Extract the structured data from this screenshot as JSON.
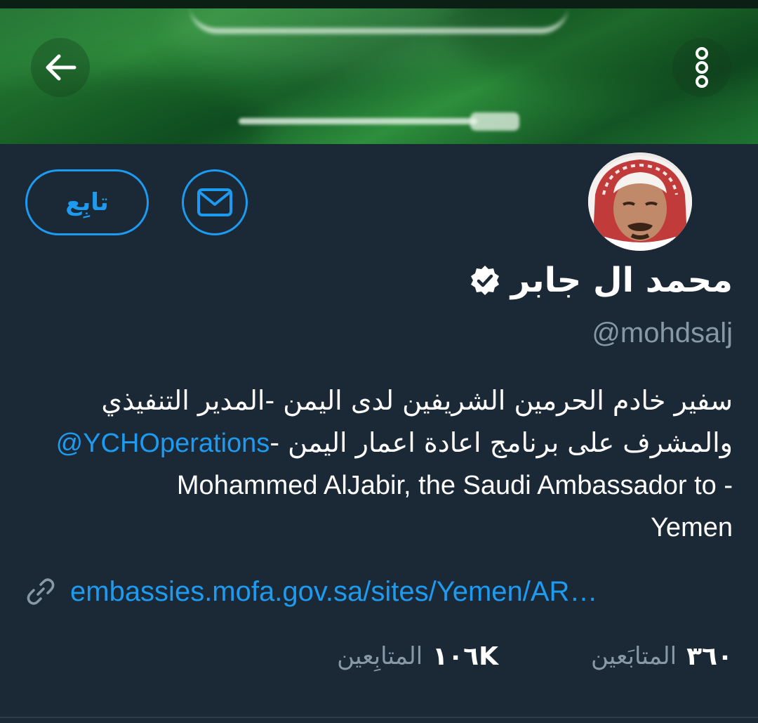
{
  "header": {
    "back_icon": "arrow-left-icon",
    "more_icon": "more-vertical-icon"
  },
  "profile": {
    "display_name": "محمد ال جابر",
    "verified_icon": "verified-badge-icon",
    "handle": "@mohdsalj",
    "bio": {
      "line1": "سفير خادم الحرمين الشريفين لدى اليمن -المدير التنفيذي",
      "line2_text": "والمشرف على برنامج اعادة اعمار اليمن -",
      "line2_mention": "@YCHOperations",
      "line3": "Mohammed AlJabir, the Saudi Ambassador to -",
      "line4": "Yemen"
    },
    "link_icon": "link-icon",
    "link": "embassies.mofa.gov.sa/sites/Yemen/AR…"
  },
  "actions": {
    "follow_label": "تابِع",
    "message_icon": "envelope-icon"
  },
  "stats": {
    "following_count": "٣٦٠",
    "following_label": "المتابَعين",
    "followers_count": "١٠٦K",
    "followers_label": "المتابِعين"
  },
  "colors": {
    "background": "#1b2836",
    "accent": "#1d9bf0",
    "secondary_text": "#8899a6"
  }
}
